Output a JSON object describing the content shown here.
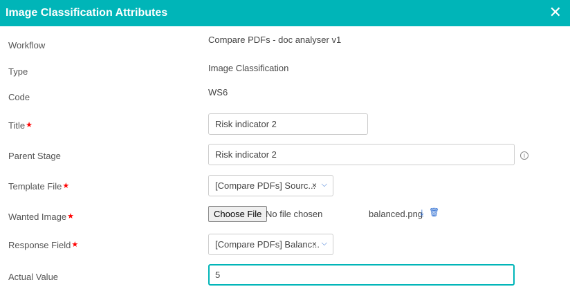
{
  "header": {
    "title": "Image Classification Attributes",
    "close_icon": "close-icon"
  },
  "fields": {
    "workflow": {
      "label": "Workflow",
      "value": "Compare PDFs - doc analyser v1"
    },
    "type": {
      "label": "Type",
      "value": "Image Classification"
    },
    "code": {
      "label": "Code",
      "value": "WS6"
    },
    "title": {
      "label": "Title",
      "value": "Risk indicator 2",
      "required": "★"
    },
    "parent_stage": {
      "label": "Parent Stage",
      "value": "Risk indicator 2",
      "info_icon": "i"
    },
    "template_file": {
      "label": "Template File",
      "value": "[Compare PDFs] Sourc...",
      "required": "★",
      "clear": "×",
      "chevron": "⌄"
    },
    "wanted_image": {
      "label": "Wanted Image",
      "required": "★",
      "button": "Choose File",
      "status": "No file chosen",
      "file_name": "balanced.png"
    },
    "response_field": {
      "label": "Response Field",
      "value": "[Compare PDFs] Balanc...",
      "required": "★",
      "clear": "×",
      "chevron": "⌄"
    },
    "actual_value": {
      "label": "Actual Value",
      "value": "5"
    }
  },
  "colors": {
    "accent": "#00b5b8",
    "required": "#ff0000",
    "link": "#2a6bd1"
  }
}
